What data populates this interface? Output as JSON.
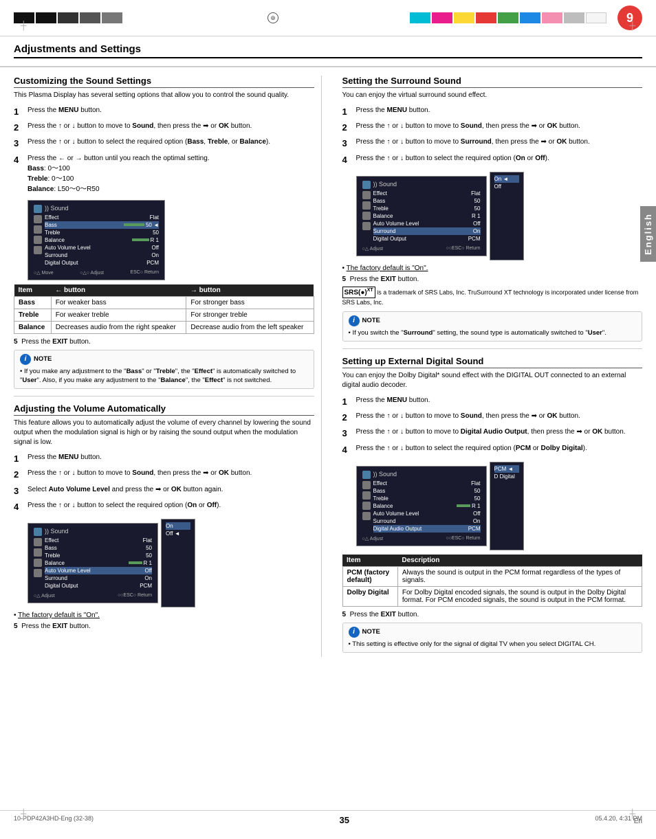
{
  "page": {
    "title": "Adjustments and Settings",
    "page_number": "9",
    "page_number_bottom": "35",
    "page_number_en": "En",
    "doc_id": "10-PDP42A3HD-Eng (32-38)",
    "date": "05.4.20, 4:31 PM"
  },
  "header": {
    "color_blocks_right": [
      "cyan",
      "magenta",
      "yellow",
      "red",
      "green",
      "blue",
      "pink",
      "gray",
      "white"
    ]
  },
  "sidebar": {
    "label": "English"
  },
  "section1": {
    "title": "Customizing the Sound Settings",
    "intro": "This Plasma Display has several setting options that allow you to control the sound quality.",
    "steps": [
      {
        "num": "1",
        "text": "Press the ",
        "bold": "MENU",
        "after": " button."
      },
      {
        "num": "2",
        "text": "Press the ↑ or ↓ button to move to ",
        "bold": "Sound",
        "after": ", then press the ➡ or ",
        "bold2": "OK",
        "after2": " button."
      },
      {
        "num": "3",
        "text": "Press the ↑ or ↓ button to select the required option (",
        "bold": "Bass",
        "after": ", ",
        "bold2": "Treble",
        "after2": ", or ",
        "bold3": "Balance",
        "after3": ")."
      },
      {
        "num": "4",
        "text": "Press the ← or → button until you reach the optimal setting."
      }
    ],
    "step4_values": [
      "Bass: 0～100",
      "Treble: 0～100",
      "Balance: L50～0～R50"
    ],
    "step5": "Press the EXIT button.",
    "screen": {
      "title": "Sound",
      "rows": [
        {
          "label": "Effect",
          "value": "Flat"
        },
        {
          "label": "Bass",
          "value": "50",
          "bar": true,
          "highlighted": true
        },
        {
          "label": "Treble",
          "value": "50"
        },
        {
          "label": "Balance",
          "value": "R 1",
          "bar": true
        },
        {
          "label": "Auto Volume Level",
          "value": "Off"
        },
        {
          "label": "Surround",
          "value": "On"
        },
        {
          "label": "Digital Output",
          "value": "PCM"
        }
      ],
      "controls": "○△ Move   ○△○ Adjust   ESC○ Return"
    },
    "table": {
      "headers": [
        "Item",
        "← button",
        "→ button"
      ],
      "rows": [
        {
          "item": "Bass",
          "left": "For weaker bass",
          "right": "For stronger bass"
        },
        {
          "item": "Treble",
          "left": "For weaker treble",
          "right": "For stronger treble"
        },
        {
          "item": "Balance",
          "left": "Decreases audio from the right speaker",
          "right": "Decrease audio from the left speaker"
        }
      ]
    },
    "note": {
      "title": "NOTE",
      "text": "If you make any adjustment to the \"Bass\" or \"Treble\", the \"Effect\" is automatically switched to \"User\". Also, if you make any adjustment to the \"Balance\", the \"Effect\" is not switched."
    }
  },
  "section2": {
    "title": "Adjusting the Volume Automatically",
    "intro": "This feature allows you to automatically adjust the volume of every channel by lowering the sound output when the modulation signal is high or by raising the sound output when the modulation signal is low.",
    "steps": [
      {
        "num": "1",
        "text": "Press the ",
        "bold": "MENU",
        "after": " button."
      },
      {
        "num": "2",
        "text": "Press the ↑ or ↓ button to move to ",
        "bold": "Sound",
        "after": ", then press the ➡ or ",
        "bold2": "OK",
        "after2": " button."
      },
      {
        "num": "3",
        "text": "Select ",
        "bold": "Auto Volume Level",
        "after": " and press the ➡ or ",
        "bold2": "OK",
        "after2": " button again."
      },
      {
        "num": "4",
        "text": "Press the ↑ or ↓ button to select the required option (",
        "bold": "On",
        "after": " or ",
        "bold2": "Off",
        "after2": ")."
      }
    ],
    "step5": "Press the EXIT button.",
    "factory_default": "The factory default is \"On\".",
    "screen": {
      "title": "Sound",
      "rows": [
        {
          "label": "Effect",
          "value": "Flat"
        },
        {
          "label": "Bass",
          "value": "50"
        },
        {
          "label": "Treble",
          "value": "50"
        },
        {
          "label": "Balance",
          "value": "R 1",
          "bar": true
        },
        {
          "label": "Auto Volume Level",
          "value": "Off",
          "highlighted": true
        },
        {
          "label": "Surround",
          "value": "On"
        },
        {
          "label": "Digital Output",
          "value": "PCM"
        }
      ],
      "popup": [
        "On",
        "Off"
      ],
      "controls": "○△ Adjust   ○○ESC○ Return"
    }
  },
  "section3": {
    "title": "Setting the Surround Sound",
    "intro": "You can enjoy the virtual surround sound effect.",
    "steps": [
      {
        "num": "1",
        "text": "Press the ",
        "bold": "MENU",
        "after": " button."
      },
      {
        "num": "2",
        "text": "Press the ↑ or ↓ button to move to ",
        "bold": "Sound",
        "after": ", then press the ➡ or ",
        "bold2": "OK",
        "after2": " button."
      },
      {
        "num": "3",
        "text": "Press the ↑ or ↓ button to move to ",
        "bold": "Surround",
        "after": ", then press the ➡ or ",
        "bold2": "OK",
        "after2": " button."
      },
      {
        "num": "4",
        "text": "Press the ↑ or ↓ button to select the required option (",
        "bold": "On",
        "after": " or ",
        "bold2": "Off",
        "after2": ")."
      }
    ],
    "step5": "Press the EXIT button.",
    "factory_default": "The factory default is \"On\".",
    "screen": {
      "title": "Sound",
      "rows": [
        {
          "label": "Effect",
          "value": "Flat"
        },
        {
          "label": "Bass",
          "value": "50"
        },
        {
          "label": "Treble",
          "value": "50"
        },
        {
          "label": "Balance",
          "value": "R 1"
        },
        {
          "label": "Auto Volume Level",
          "value": "Off"
        },
        {
          "label": "Surround",
          "value": "On",
          "highlighted": true
        },
        {
          "label": "Digital Output",
          "value": "PCM"
        }
      ],
      "popup": [
        "On",
        "Off"
      ],
      "controls": "○△ Adjust   ○○ESC○ Return"
    },
    "srs": {
      "logo": "SRS(●)",
      "text": "is a trademark of SRS Labs, Inc. TruSurround XT technology is incorporated under license from SRS Labs, Inc."
    },
    "note": {
      "title": "NOTE",
      "text": "If you switch the \"Surround\" setting, the sound type is automatically switched to \"User\"."
    }
  },
  "section4": {
    "title": "Setting up External Digital Sound",
    "intro": "You can enjoy the Dolby Digital* sound effect with the DIGITAL OUT connected to an external digital audio decoder.",
    "steps": [
      {
        "num": "1",
        "text": "Press the ",
        "bold": "MENU",
        "after": " button."
      },
      {
        "num": "2",
        "text": "Press the ↑ or ↓ button to move to ",
        "bold": "Sound",
        "after": ", then press the ➡ or ",
        "bold2": "OK",
        "after2": " button."
      },
      {
        "num": "3",
        "text": "Press the ↑ or ↓ button to move to ",
        "bold": "Digital Audio Output",
        "after": ", then press the ➡ or ",
        "bold2": "OK",
        "after2": " button."
      },
      {
        "num": "4",
        "text": "Press the ↑ or ↓ button to select the required option (",
        "bold": "PCM",
        "after": " or ",
        "bold2": "Dolby Digital",
        "after2": ")."
      }
    ],
    "step5": "Press the EXIT button.",
    "screen": {
      "title": "Sound",
      "rows": [
        {
          "label": "Effect",
          "value": "Flat"
        },
        {
          "label": "Bass",
          "value": "50"
        },
        {
          "label": "Treble",
          "value": "50"
        },
        {
          "label": "Balance",
          "value": "R 1",
          "bar": true
        },
        {
          "label": "Auto Volume Level",
          "value": "Off"
        },
        {
          "label": "Surround",
          "value": "On"
        },
        {
          "label": "Digital Audio Output",
          "value": "PCM",
          "highlighted": true
        }
      ],
      "popup": [
        "PCM",
        "D Digital"
      ],
      "controls": "○△ Adjust   ○○ESC○ Return"
    },
    "table": {
      "headers": [
        "Item",
        "Description"
      ],
      "rows": [
        {
          "item": "PCM (factory default)",
          "desc": "Always the sound is output in the PCM format regardless of the types of signals."
        },
        {
          "item": "Dolby Digital",
          "desc": "For Dolby Digital encoded signals, the sound is output in the Dolby Digital format. For PCM encoded signals, the sound is output in the PCM format."
        }
      ]
    },
    "note": {
      "title": "NOTE",
      "text": "This setting is effective only for the signal of digital TV when you select DIGITAL CH."
    }
  }
}
